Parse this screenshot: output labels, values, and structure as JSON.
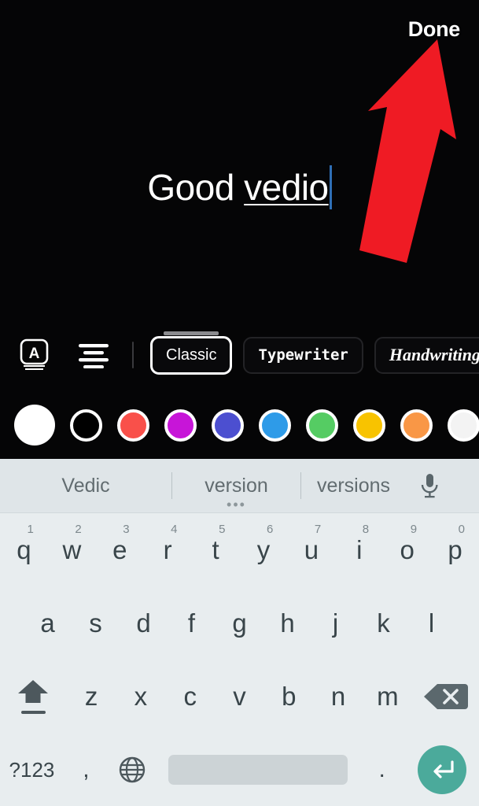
{
  "canvas": {
    "done_label": "Done",
    "annotation_icon": "red-up-arrow",
    "text": {
      "prefix": "Good ",
      "misspelled_word": "vedio",
      "full": "Good vedio"
    },
    "caret_color": "#2f6fb5"
  },
  "style_bar": {
    "text_style_icon": "letter-a-box-icon",
    "align_icon": "align-center-icon",
    "chips": [
      {
        "label": "Classic",
        "style": "classic",
        "selected": true
      },
      {
        "label": "Typewriter",
        "style": "typewriter",
        "selected": false
      },
      {
        "label": "Handwriting",
        "style": "handwriting",
        "selected": false
      }
    ]
  },
  "palette": {
    "swatches": [
      {
        "name": "white",
        "hex": "#ffffff",
        "selected": true
      },
      {
        "name": "black",
        "hex": "#000000",
        "selected": false
      },
      {
        "name": "red",
        "hex": "#f9504a",
        "selected": false
      },
      {
        "name": "magenta",
        "hex": "#c715d8",
        "selected": false
      },
      {
        "name": "indigo",
        "hex": "#4c4fd0",
        "selected": false
      },
      {
        "name": "blue",
        "hex": "#2e9be8",
        "selected": false
      },
      {
        "name": "green",
        "hex": "#55cc63",
        "selected": false
      },
      {
        "name": "yellow",
        "hex": "#f8c300",
        "selected": false
      },
      {
        "name": "orange",
        "hex": "#f99746",
        "selected": false
      },
      {
        "name": "white-2",
        "hex": "#f3f3f3",
        "selected": false
      }
    ]
  },
  "keyboard": {
    "suggestions": [
      {
        "text": "Vedic",
        "has_dots": false
      },
      {
        "text": "version",
        "has_dots": true
      },
      {
        "text": "versions",
        "has_dots": false
      }
    ],
    "dots": "•••",
    "mic_icon": "microphone-icon",
    "row1": [
      {
        "key": "q",
        "hint": "1"
      },
      {
        "key": "w",
        "hint": "2"
      },
      {
        "key": "e",
        "hint": "3"
      },
      {
        "key": "r",
        "hint": "4"
      },
      {
        "key": "t",
        "hint": "5"
      },
      {
        "key": "y",
        "hint": "6"
      },
      {
        "key": "u",
        "hint": "7"
      },
      {
        "key": "i",
        "hint": "8"
      },
      {
        "key": "o",
        "hint": "9"
      },
      {
        "key": "p",
        "hint": "0"
      }
    ],
    "row2": [
      {
        "key": "a"
      },
      {
        "key": "s"
      },
      {
        "key": "d"
      },
      {
        "key": "f"
      },
      {
        "key": "g"
      },
      {
        "key": "h"
      },
      {
        "key": "j"
      },
      {
        "key": "k"
      },
      {
        "key": "l"
      }
    ],
    "row3": {
      "shift_icon": "shift-caps-lock-icon",
      "letters": [
        {
          "key": "z"
        },
        {
          "key": "x"
        },
        {
          "key": "c"
        },
        {
          "key": "v"
        },
        {
          "key": "b"
        },
        {
          "key": "n"
        },
        {
          "key": "m"
        }
      ],
      "delete_icon": "backspace-icon"
    },
    "row4": {
      "symbols_label": "?123",
      "comma_label": ",",
      "globe_icon": "language-globe-icon",
      "space_label": "",
      "period_label": ".",
      "enter_icon": "enter-return-icon",
      "enter_bg": "#4baa9b"
    }
  }
}
